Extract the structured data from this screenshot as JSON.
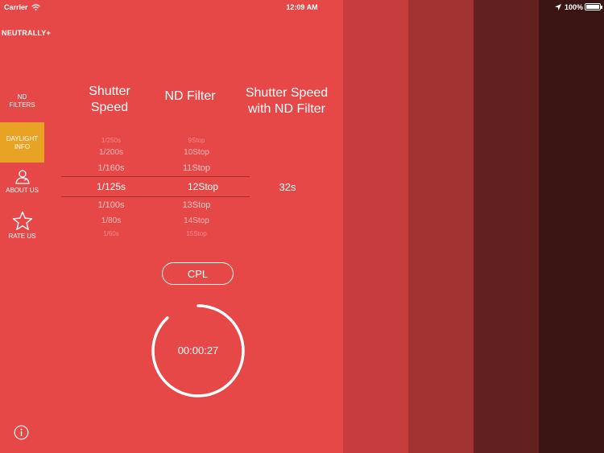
{
  "status_bar": {
    "carrier": "Carrier",
    "time": "12:09 AM",
    "battery": "100%",
    "battery_level": 1.0
  },
  "brand": "NEUTRALLY+",
  "sidebar": {
    "items": [
      {
        "label_line1": "ND",
        "label_line2": "FILTERS",
        "active": false
      },
      {
        "label_line1": "DAYLIGHT",
        "label_line2": "INFO",
        "active": true
      },
      {
        "label": "ABOUT US",
        "icon": "person-icon"
      },
      {
        "label": "RATE US",
        "icon": "star-icon"
      }
    ]
  },
  "columns": {
    "shutter_line1": "Shutter",
    "shutter_line2": "Speed",
    "nd_filter": "ND Filter",
    "result_line1": "Shutter Speed",
    "result_line2": "with ND Filter"
  },
  "picker": {
    "shutter": [
      "1/250s",
      "1/200s",
      "1/160s",
      "1/125s",
      "1/100s",
      "1/80s",
      "1/60s"
    ],
    "nd": [
      "9Stop",
      "10Stop",
      "11Stop",
      "12Stop",
      "13Stop",
      "14Stop",
      "15Stop"
    ],
    "selected_index": 3
  },
  "result": "32s",
  "cpl_label": "CPL",
  "timer": {
    "display": "00:00:27",
    "progress": 0.88
  },
  "colors": {
    "accent": "#e64848",
    "active_tab": "#e8a324",
    "panel_2": "#c73d3d",
    "panel_3": "#a33232",
    "panel_4": "#632020",
    "panel_5": "#3b1414"
  }
}
